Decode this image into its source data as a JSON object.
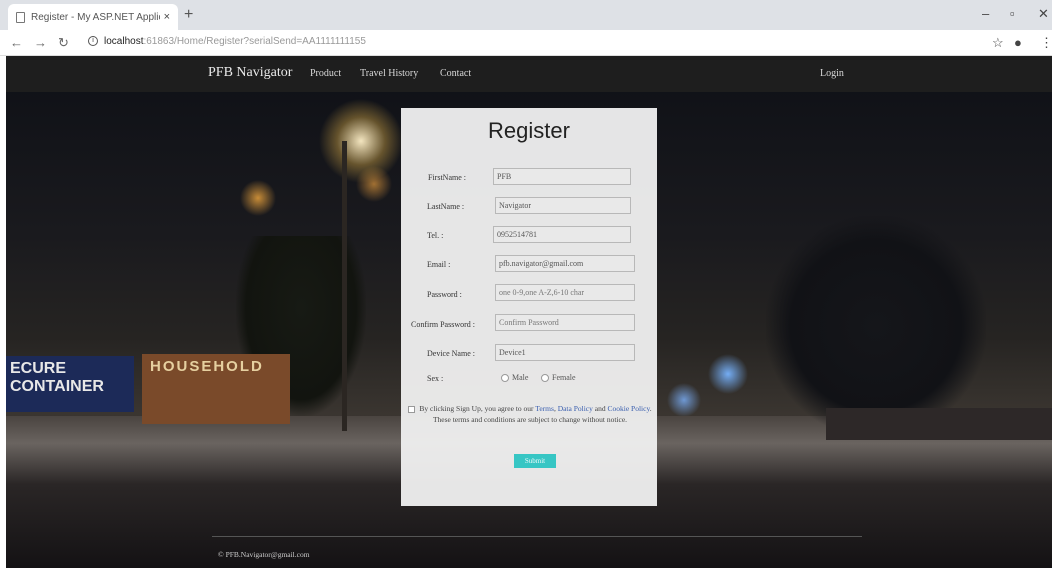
{
  "browser": {
    "tab_title": "Register - My ASP.NET Application",
    "tab_close": "×",
    "new_tab": "+",
    "url_host": "localhost",
    "url_path": ":61863/Home/Register?serialSend=AA1111111155",
    "win_minimize": "–",
    "win_maximize": "▫",
    "win_close": "✕"
  },
  "navbar": {
    "brand": "PFB Navigator",
    "links": [
      "Product",
      "Travel History",
      "Contact"
    ],
    "login": "Login"
  },
  "background": {
    "billboard_text": "HOUSEHOLD",
    "container_text": "ECURE CONTAINER"
  },
  "form": {
    "title": "Register",
    "fields": [
      {
        "label": "FirstName :",
        "value": "PFB",
        "placeholder": ""
      },
      {
        "label": "LastName :",
        "value": "Navigator",
        "placeholder": ""
      },
      {
        "label": "Tel. :",
        "value": "0952514781",
        "placeholder": ""
      },
      {
        "label": "Email :",
        "value": "pfb.navigator@gmail.com",
        "placeholder": ""
      },
      {
        "label": "Password :",
        "value": "",
        "placeholder": "one 0-9,one A-Z,6-10 char"
      },
      {
        "label": "Confirm Password :",
        "value": "",
        "placeholder": "Confirm Password"
      },
      {
        "label": "Device Name :",
        "value": "Device1",
        "placeholder": ""
      }
    ],
    "sex_label": "Sex :",
    "sex_options": [
      "Male",
      "Female"
    ],
    "terms_prefix": "By clicking Sign Up, you agree to our",
    "terms_link1": "Terms",
    "terms_link2": "Data Policy",
    "terms_and": "and",
    "terms_link3": "Cookie Policy",
    "terms_suffix": ". These terms and conditions are subject to change without notice.",
    "submit_label": "Submit"
  },
  "footer": {
    "text": "© PFB.Navigator@gmail.com"
  }
}
